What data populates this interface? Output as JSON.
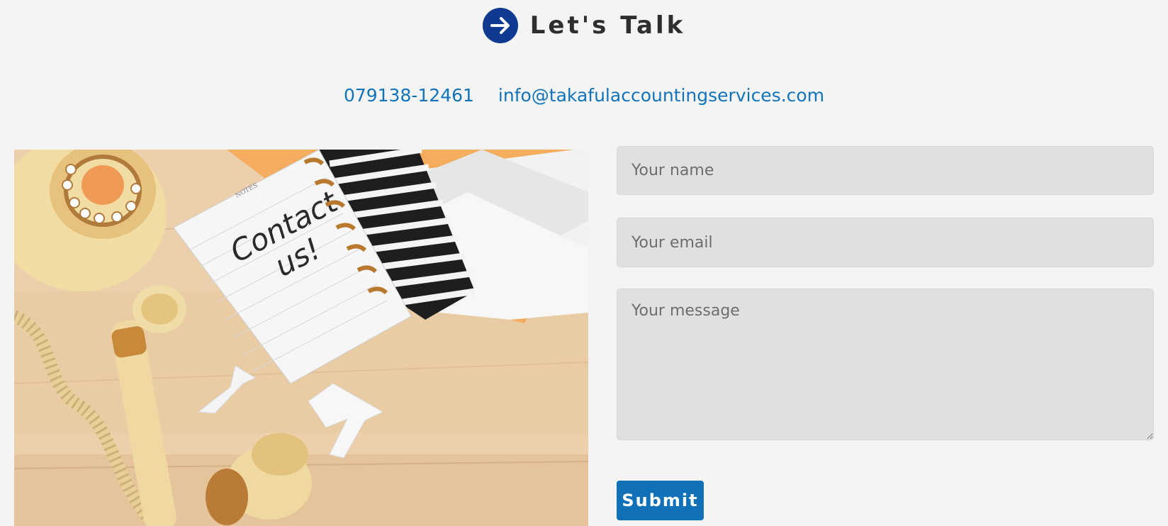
{
  "heading": {
    "title": "Let's Talk",
    "icon": "arrow-right-circle-icon",
    "accent": "#0f3a8f"
  },
  "contact": {
    "phone": "079138-12461",
    "email": "info@takafulaccountingservices.com",
    "link_color": "#1174ba"
  },
  "photo": {
    "notebook_text_line1": "Contact",
    "notebook_text_line2": "us!",
    "notebook_header": "NOTES"
  },
  "form": {
    "name_placeholder": "Your name",
    "email_placeholder": "Your email",
    "message_placeholder": "Your message",
    "submit_label": "Submit",
    "button_color": "#1070b8"
  }
}
